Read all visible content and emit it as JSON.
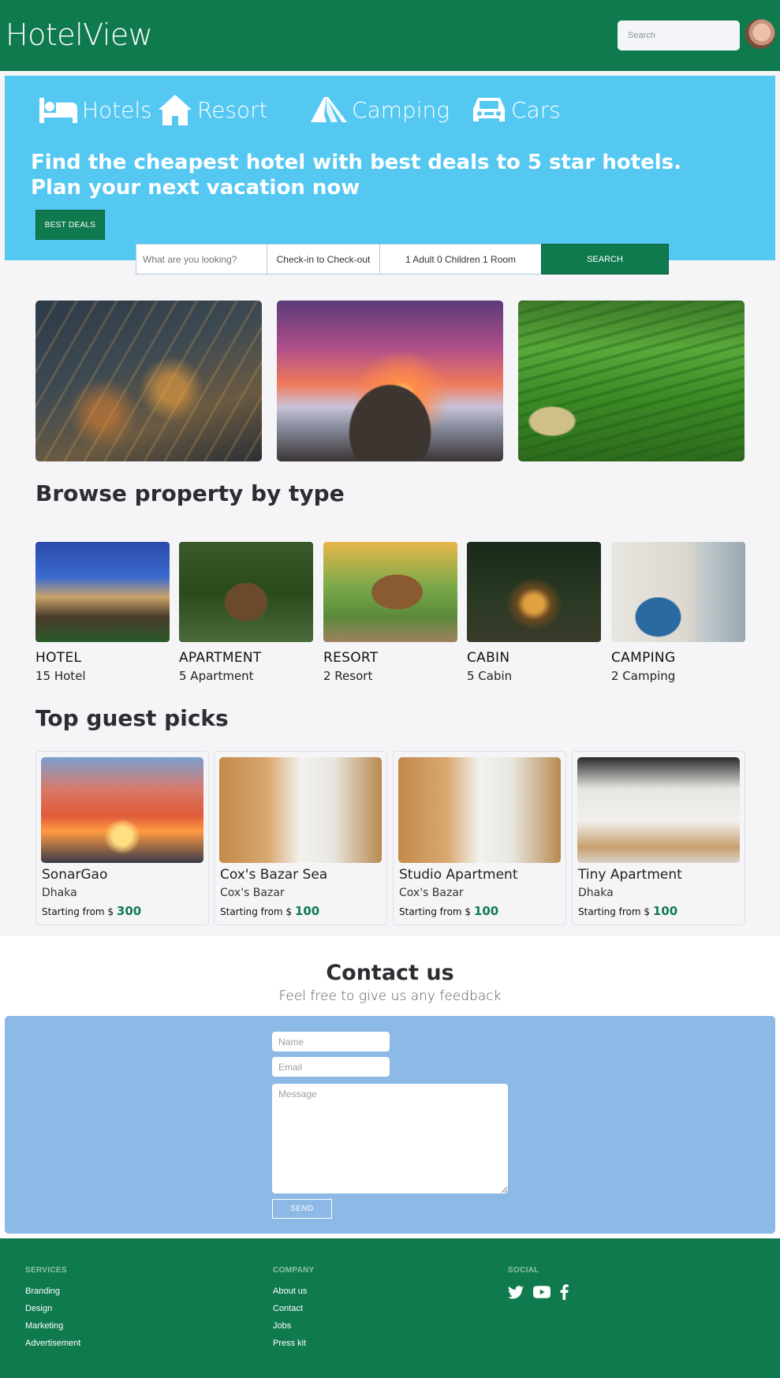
{
  "navbar": {
    "brand": "HotelView",
    "search_placeholder": "Search"
  },
  "hero": {
    "categories": [
      {
        "label": "Hotels",
        "icon": "bed-icon"
      },
      {
        "label": "Resort",
        "icon": "house-icon"
      },
      {
        "label": "Camping",
        "icon": "tent-icon"
      },
      {
        "label": "Cars",
        "icon": "car-icon"
      }
    ],
    "headline_line1": "Find the cheapest hotel with best deals to 5 star hotels.",
    "headline_line2": "Plan your next vacation now",
    "deals_button": "BEST DEALS",
    "accent_color": "#55c8f2",
    "brand_color": "#107a4f"
  },
  "search_bar": {
    "what_placeholder": "What are you looking?",
    "dates": "Check-in to Check-out",
    "guests": "1 Adult 0 Children 1 Room",
    "button": "SEARCH"
  },
  "browse": {
    "title": "Browse property by type",
    "types": [
      {
        "name": "HOTEL",
        "count": "15 Hotel"
      },
      {
        "name": "APARTMENT",
        "count": "5 Apartment"
      },
      {
        "name": "RESORT",
        "count": "2 Resort"
      },
      {
        "name": "CABIN",
        "count": "5 Cabin"
      },
      {
        "name": "CAMPING",
        "count": "2 Camping"
      }
    ]
  },
  "picks": {
    "title": "Top guest picks",
    "price_prefix": "Starting from $",
    "items": [
      {
        "name": "SonarGao",
        "city": "Dhaka",
        "price": "300"
      },
      {
        "name": "Cox's Bazar Sea",
        "city": "Cox's Bazar",
        "price": "100"
      },
      {
        "name": "Studio Apartment",
        "city": "Cox's Bazar",
        "price": "100"
      },
      {
        "name": "Tiny Apartment",
        "city": "Dhaka",
        "price": "100"
      }
    ]
  },
  "contact": {
    "title": "Contact us",
    "subtitle": "Feel free to give us any feedback",
    "name_placeholder": "Name",
    "email_placeholder": "Email",
    "message_placeholder": "Message",
    "send": "SEND"
  },
  "footer": {
    "services": {
      "heading": "SERVICES",
      "links": [
        "Branding",
        "Design",
        "Marketing",
        "Advertisement"
      ]
    },
    "company": {
      "heading": "COMPANY",
      "links": [
        "About us",
        "Contact",
        "Jobs",
        "Press kit"
      ]
    },
    "social": {
      "heading": "SOCIAL",
      "icons": [
        "twitter-icon",
        "youtube-icon",
        "facebook-icon"
      ]
    }
  }
}
